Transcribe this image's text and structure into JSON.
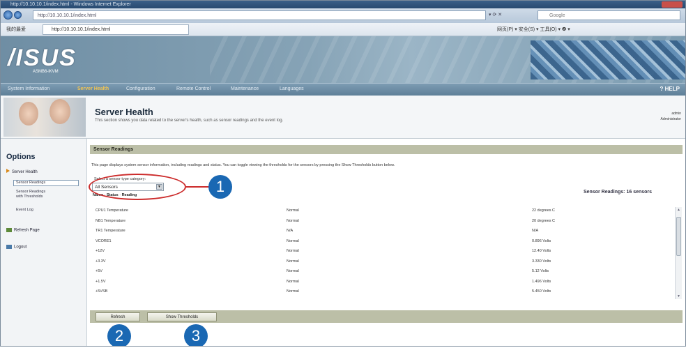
{
  "browser": {
    "title": "http://10.10.10.1/index.html - Windows Internet Explorer",
    "address": "http://10.10.10.1/index.html",
    "search_placeholder": "Google",
    "favorites_label": "我的最爱",
    "tab_title": "http://10.10.10.1/index.html",
    "command_bar": "网页(P) ▾  安全(S) ▾  工具(O) ▾  ❷ ▾"
  },
  "banner": {
    "logo": "/ISUS",
    "sublogo": "ASMB6-iKVM"
  },
  "menu": {
    "items": [
      "System Information",
      "Server Health",
      "Configuration",
      "Remote Control",
      "Maintenance",
      "Languages"
    ],
    "active_index": 1,
    "help": "? HELP"
  },
  "header": {
    "title": "Server Health",
    "description": "This section shows you data related to the server's health, such as sensor readings and the event log.",
    "user_name": "admin",
    "user_role": "Administrator"
  },
  "sidebar": {
    "title": "Options",
    "server_health": "Server Health",
    "sensor_readings": "Sensor Readings",
    "sensor_thresholds_1": "Sensor Readings",
    "sensor_thresholds_2": "with Thresholds",
    "event_log": "Event Log",
    "refresh_page": "Refresh Page",
    "logout": "Logout"
  },
  "main": {
    "section_title": "Sensor Readings",
    "intro": "This page displays system sensor information, including readings and status. You can toggle viewing the thresholds for the sensors by pressing the Show Thresholds button below.",
    "select_prompt": "Select a sensor type category:",
    "select_value": "All Sensors",
    "sort_prefix": "Name",
    "sort_sep1": "Status",
    "sort_sep2": "Reading",
    "count_label": "Sensor Readings: 16 sensors",
    "refresh_button": "Refresh",
    "thresholds_button": "Show Thresholds"
  },
  "sensors": [
    {
      "name": "CPU1 Temperature",
      "status": "Normal",
      "reading": "22 degrees C"
    },
    {
      "name": "NB1 Temperature",
      "status": "Normal",
      "reading": "20 degrees C"
    },
    {
      "name": "TR1 Temperature",
      "status": "N/A",
      "reading": "N/A"
    },
    {
      "name": "VCORE1",
      "status": "Normal",
      "reading": "0.896 Volts"
    },
    {
      "name": "+12V",
      "status": "Normal",
      "reading": "12.40 Volts"
    },
    {
      "name": "+3.3V",
      "status": "Normal",
      "reading": "3.330 Volts"
    },
    {
      "name": "+5V",
      "status": "Normal",
      "reading": "5.12 Volts"
    },
    {
      "name": "+1.5V",
      "status": "Normal",
      "reading": "1.496 Volts"
    },
    {
      "name": "+5VSB",
      "status": "Normal",
      "reading": "5.450 Volts"
    }
  ],
  "callouts": [
    "1",
    "2",
    "3"
  ],
  "colors": {
    "accent_red": "#cc2b2b",
    "callout_blue": "#1a68b3",
    "section_bar": "#bcbfa7"
  }
}
